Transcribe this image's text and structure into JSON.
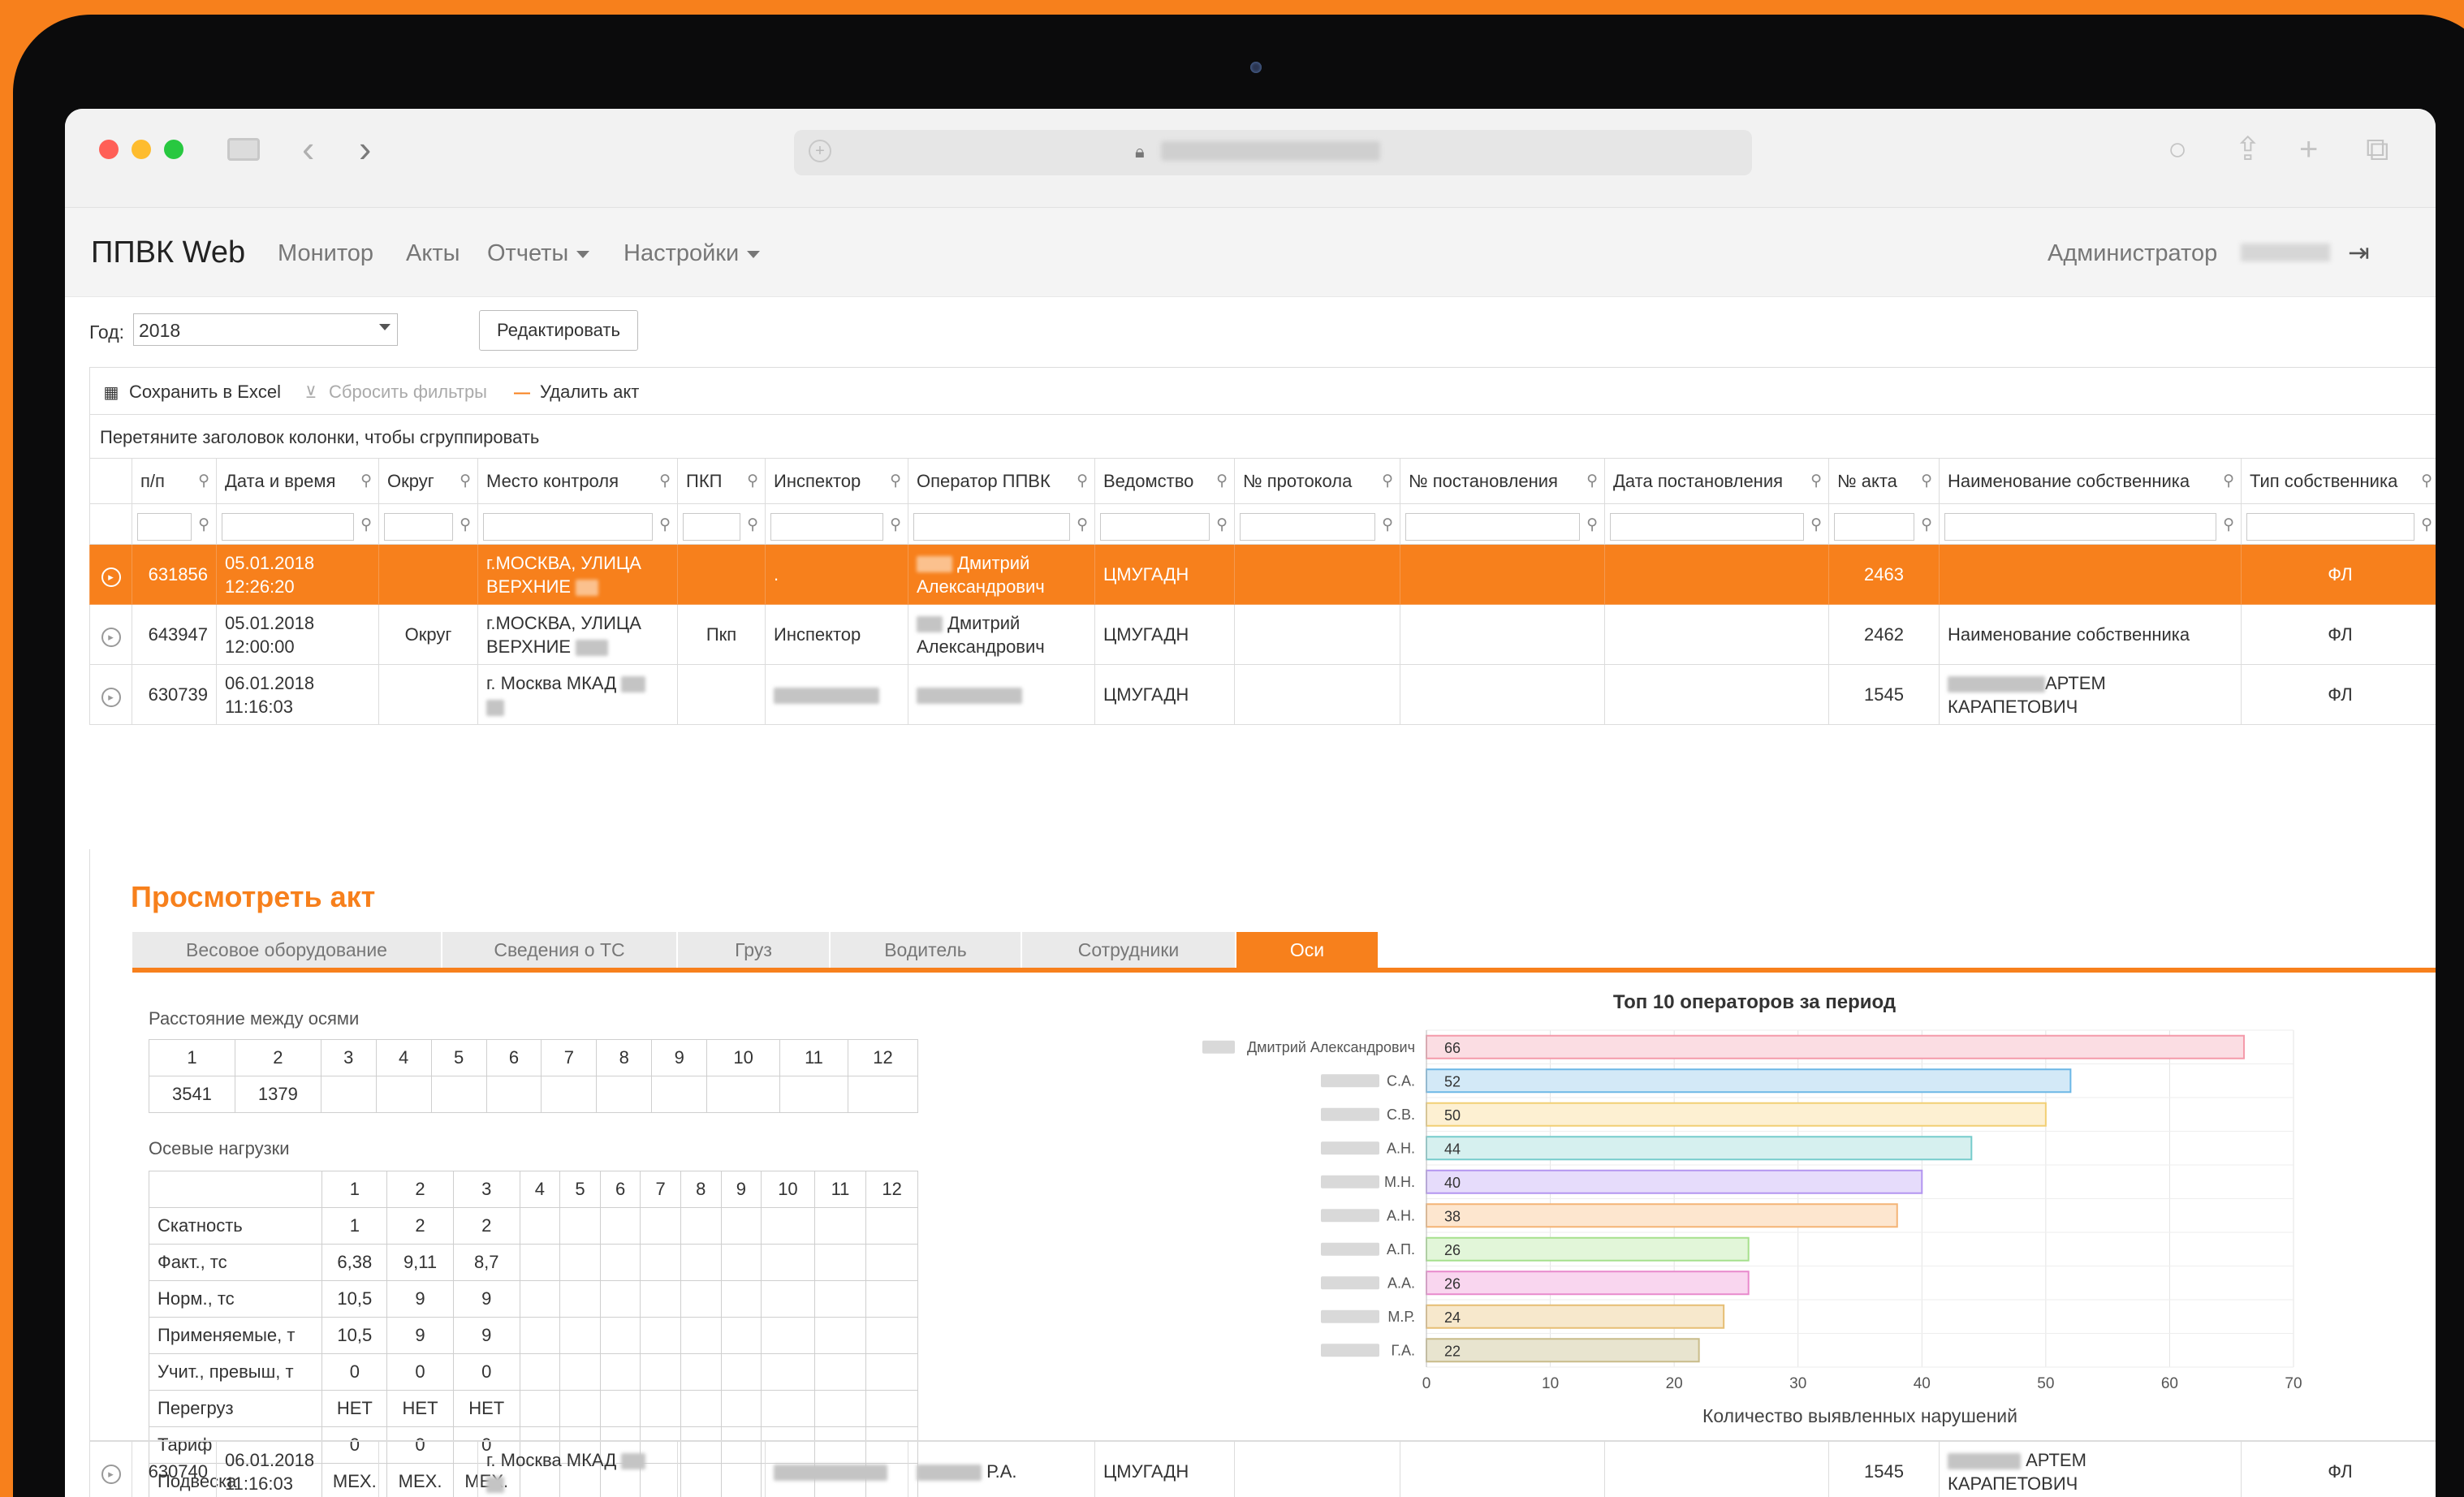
{
  "app": {
    "brand": "ППВК Web",
    "nav": [
      {
        "label": "Монитор",
        "dropdown": false
      },
      {
        "label": "Акты",
        "dropdown": false
      },
      {
        "label": "Отчеты",
        "dropdown": true
      },
      {
        "label": "Настройки",
        "dropdown": true
      }
    ],
    "user_label": "Администратор"
  },
  "filters": {
    "year_label": "Год:",
    "year_value": "2018",
    "edit_button": "Редактировать"
  },
  "toolbar": {
    "save_excel": "Сохранить в Excel",
    "reset_filters": "Сбросить фильтры",
    "delete_act": "Удалить акт"
  },
  "group_hint": "Перетяните заголовок колонки, чтобы сгруппировать",
  "columns": [
    "п/п",
    "Дата и время",
    "Округ",
    "Место контроля",
    "ПКП",
    "Инспектор",
    "Оператор ППВК",
    "Ведомство",
    "№ протокола",
    "№ постановления",
    "Дата постановления",
    "№ акта",
    "Наименование собственника",
    "Тип собственника"
  ],
  "rows": [
    {
      "id": "631856",
      "date": "05.01.2018",
      "time": "12:26:20",
      "district": "",
      "place_1": "г.МОСКВА, УЛИЦА",
      "place_2": "ВЕРХНИЕ",
      "pkp": "",
      "inspector": ".",
      "operator_1": "Дмитрий",
      "operator_2": "Александрович",
      "agency": "ЦМУГАДН",
      "protocol": "",
      "decree": "",
      "decree_date": "",
      "act": "2463",
      "owner_1": "",
      "owner_2": "",
      "owner_type": "ФЛ"
    },
    {
      "id": "643947",
      "date": "05.01.2018",
      "time": "12:00:00",
      "district": "Округ",
      "place_1": "г.МОСКВА, УЛИЦА",
      "place_2": "ВЕРХНИЕ",
      "pkp": "Пкп",
      "inspector": "Инспектор",
      "operator_1": "Дмитрий",
      "operator_2": "Александрович",
      "agency": "ЦМУГАДН",
      "protocol": "",
      "decree": "",
      "decree_date": "",
      "act": "2462",
      "owner_1": "Наименование собственника",
      "owner_2": "",
      "owner_type": "ФЛ"
    },
    {
      "id": "630739",
      "date": "06.01.2018",
      "time": "11:16:03",
      "district": "",
      "place_1": "г. Москва МКАД",
      "place_2": "",
      "pkp": "",
      "inspector": "",
      "operator_1": "",
      "operator_2": "",
      "agency": "ЦМУГАДН",
      "protocol": "",
      "decree": "",
      "decree_date": "",
      "act": "1545",
      "owner_1": "АРТЕМ",
      "owner_2": "КАРАПЕТОВИЧ",
      "owner_type": "ФЛ"
    },
    {
      "id": "630740",
      "date": "06.01.2018",
      "time": "11:16:03",
      "district": "",
      "place_1": "г. Москва МКАД",
      "place_2": "",
      "pkp": "",
      "inspector": "",
      "operator_1": "Р.А.",
      "operator_2": "",
      "agency": "ЦМУГАДН",
      "protocol": "",
      "decree": "",
      "decree_date": "",
      "act": "1545",
      "owner_1": "АРТЕМ",
      "owner_2": "КАРАПЕТОВИЧ",
      "owner_type": "ФЛ"
    }
  ],
  "detail": {
    "title": "Просмотреть акт",
    "tabs": [
      "Весовое оборудование",
      "Сведения о ТС",
      "Груз",
      "Водитель",
      "Сотрудники",
      "Оси"
    ],
    "active_tab": "Оси",
    "distance_title": "Расстояние между осями",
    "distance_headers": [
      "1",
      "2",
      "3",
      "4",
      "5",
      "6",
      "7",
      "8",
      "9",
      "10",
      "11",
      "12"
    ],
    "distance_values": [
      "3541",
      "1379",
      "",
      "",
      "",
      "",
      "",
      "",
      "",
      "",
      "",
      ""
    ],
    "loads_title": "Осевые нагрузки",
    "loads_headers": [
      "1",
      "2",
      "3",
      "4",
      "5",
      "6",
      "7",
      "8",
      "9",
      "10",
      "11",
      "12"
    ],
    "loads_rows": [
      {
        "label": "Скатность",
        "values": [
          "1",
          "2",
          "2"
        ]
      },
      {
        "label": "Факт., тс",
        "values": [
          "6,38",
          "9,11",
          "8,7"
        ]
      },
      {
        "label": "Норм., тс",
        "values": [
          "10,5",
          "9",
          "9"
        ]
      },
      {
        "label": "Применяемые, т",
        "values": [
          "10,5",
          "9",
          "9"
        ]
      },
      {
        "label": "Учит., превыш, т",
        "values": [
          "0",
          "0",
          "0"
        ]
      },
      {
        "label": "Перегруз",
        "values": [
          "НЕТ",
          "НЕТ",
          "НЕТ"
        ]
      },
      {
        "label": "Тариф",
        "values": [
          "0",
          "0",
          "0"
        ]
      },
      {
        "label": "Подвеска",
        "values": [
          "МЕХ.",
          "МЕХ.",
          "МЕХ."
        ]
      }
    ]
  },
  "chart_data": {
    "type": "bar",
    "orientation": "horizontal",
    "title": "Топ 10 операторов за период",
    "xlabel": "Количество выявленных нарушений",
    "ylabel": "",
    "xlim": [
      0,
      70
    ],
    "xticks": [
      0,
      10,
      20,
      30,
      40,
      50,
      60,
      70
    ],
    "grid": true,
    "categories": [
      "Дмитрий Александрович",
      "С.А.",
      "С.В.",
      "А.Н.",
      "М.Н.",
      "А.Н.",
      "А.П.",
      "А.А.",
      "М.Р.",
      "Г.А."
    ],
    "values": [
      66,
      52,
      50,
      44,
      40,
      38,
      26,
      26,
      24,
      22
    ],
    "fills": [
      "#fbdde3",
      "#d3e9f7",
      "#fdf0d2",
      "#d6f0ef",
      "#e6dcfb",
      "#fde6cf",
      "#e2f6d9",
      "#f9d6ef",
      "#f7e8cc",
      "#e8e4cf"
    ],
    "strokes": [
      "#f49aaa",
      "#6cb7e6",
      "#f2cf74",
      "#77cccc",
      "#b395f0",
      "#f4b476",
      "#a6e08d",
      "#e889cc",
      "#e6be74",
      "#c9bc8a"
    ]
  }
}
